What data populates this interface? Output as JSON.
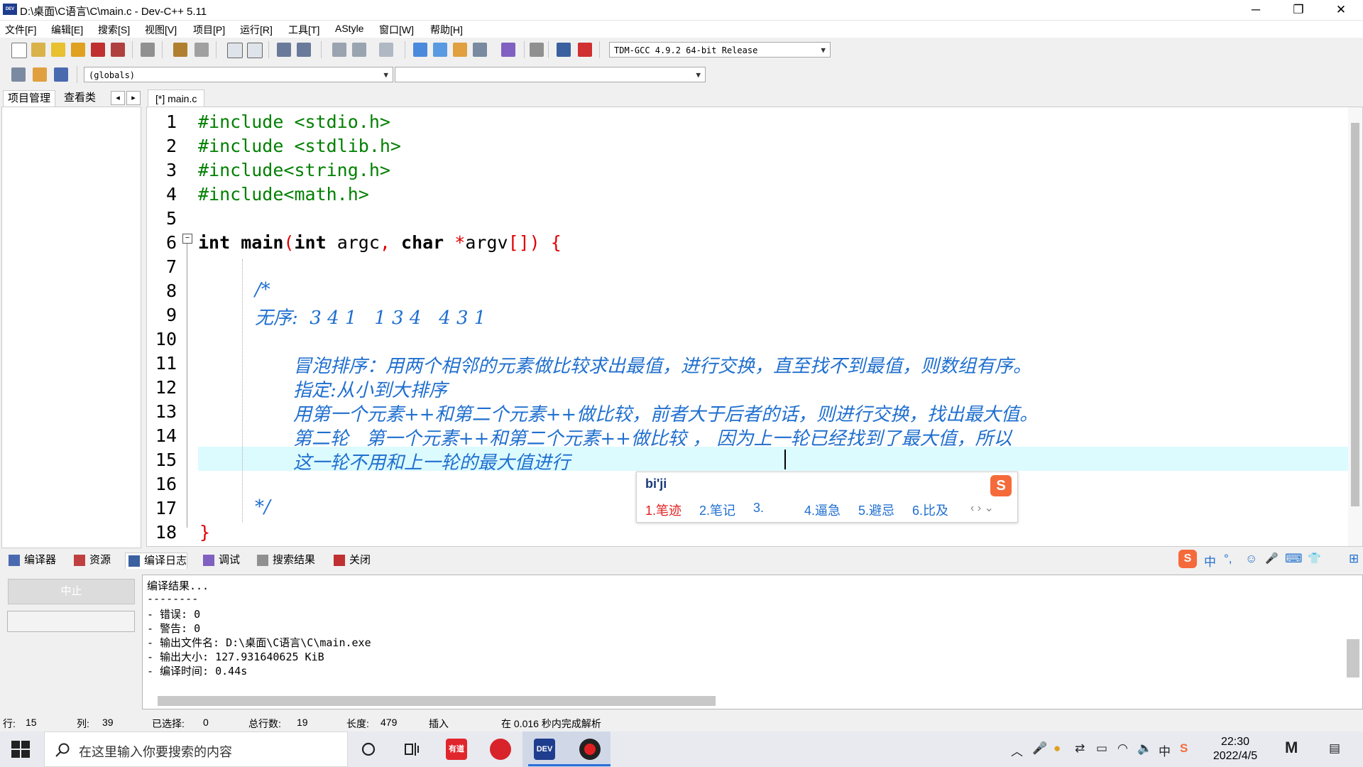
{
  "window": {
    "title": "D:\\桌面\\C语言\\C\\main.c - Dev-C++ 5.11",
    "logo": "DEV",
    "minimize": "─",
    "restore": "❐",
    "close": "✕"
  },
  "menu": [
    "文件[F]",
    "编辑[E]",
    "搜索[S]",
    "视图[V]",
    "项目[P]",
    "运行[R]",
    "工具[T]",
    "AStyle",
    "窗口[W]",
    "帮助[H]"
  ],
  "toolbar": {
    "compiler_select": "TDM-GCC 4.9.2 64-bit Release",
    "scope_select": "(globals)",
    "function_select": ""
  },
  "left_panel": {
    "tabs": [
      "项目管理",
      "查看类"
    ],
    "nav_prev": "◂",
    "nav_next": "▸"
  },
  "editor": {
    "tab_label": "[*] main.c",
    "line_numbers": [
      "1",
      "2",
      "3",
      "4",
      "5",
      "6",
      "7",
      "8",
      "9",
      "10",
      "11",
      "12",
      "13",
      "14",
      "15",
      "16",
      "17",
      "18"
    ],
    "lines": {
      "l1": "#include <stdio.h>",
      "l2": "#include <stdlib.h>",
      "l3": "#include<string.h>",
      "l4": "#include<math.h>",
      "l6_kw1": "int",
      "l6_a": " main",
      "l6_p1": "(",
      "l6_kw2": "int",
      "l6_b": " argc",
      "l6_c1": ",",
      "l6_kw3": " char",
      "l6_s": " *",
      "l6_d": "argv",
      "l6_br": "[])",
      "l6_e": " {",
      "l8": "/*",
      "l9": "无序:  3 4 1   1 3 4   4 3 1",
      "l11": "冒泡排序：用两个相邻的元素做比较求出最值，进行交换，直至找不到最值，则数组有序。",
      "l12": "指定:从小到大排序",
      "l13": "用第一个元素++和第二个元素++做比较，前者大于后者的话，则进行交换，找出最大值。",
      "l14": "第二轮   第一个元素++和第二个元素++做比较 ， 因为上一轮已经找到了最大值，所以",
      "l15": "这一轮不用和上一轮的最大值进行",
      "l17": "*/",
      "l18": "}"
    },
    "fold_marker": "−"
  },
  "ime": {
    "input": "bi'ji",
    "logo": "S",
    "candidates": [
      "1.笔迹",
      "2.笔记",
      "3.",
      "4.逼急",
      "5.避忌",
      "6.比及"
    ],
    "nav": "‹ › ⌄",
    "toolbar": [
      "S",
      "中",
      "°,",
      "☺",
      "🎤",
      "⌨",
      "👕",
      "⊞"
    ]
  },
  "bottom_tabs": [
    "编译器",
    "资源",
    "编译日志",
    "调试",
    "搜索结果",
    "关闭"
  ],
  "log": {
    "stop_label": "中止",
    "lines": [
      "编译结果...",
      "--------",
      "- 错误: 0",
      "- 警告: 0",
      "- 输出文件名: D:\\桌面\\C语言\\C\\main.exe",
      "- 输出大小: 127.931640625 KiB",
      "- 编译时间: 0.44s"
    ]
  },
  "status": {
    "row_label": "行:",
    "row": "15",
    "col_label": "列:",
    "col": "39",
    "sel_label": "已选择:",
    "sel": "0",
    "total_label": "总行数:",
    "total": "19",
    "len_label": "长度:",
    "len": "479",
    "mode": "插入",
    "parse": "在 0.016 秒内完成解析"
  },
  "taskbar": {
    "search_placeholder": "在这里输入你要搜索的内容",
    "time": "22:30",
    "date": "2022/4/5",
    "app_youdao": "有道",
    "app_dev": "DEV"
  },
  "colors": {
    "comment": "#1f6fcf",
    "preprocessor": "#008000",
    "punct": "#e00000",
    "current_line": "#dcfbff"
  }
}
